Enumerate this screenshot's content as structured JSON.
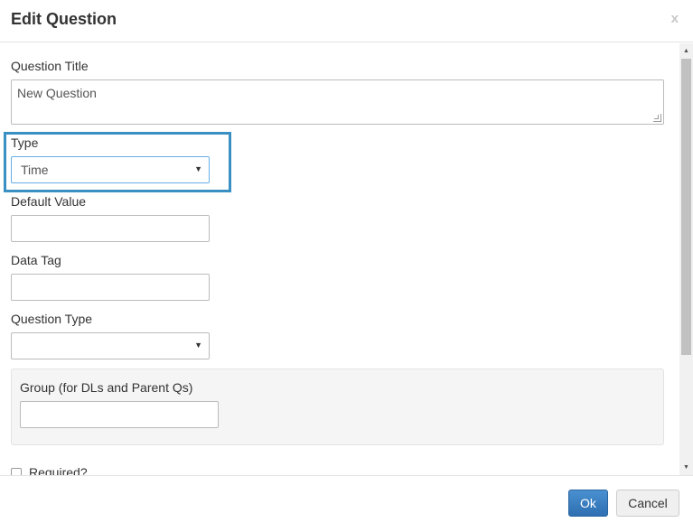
{
  "dialog": {
    "title": "Edit Question",
    "close_label": "x"
  },
  "form": {
    "question_title": {
      "label": "Question Title",
      "value": "New Question"
    },
    "type": {
      "label": "Type",
      "value": "Time"
    },
    "default_value": {
      "label": "Default Value",
      "value": ""
    },
    "data_tag": {
      "label": "Data Tag",
      "value": ""
    },
    "question_type": {
      "label": "Question Type",
      "value": ""
    },
    "group": {
      "label": "Group (for DLs and Parent Qs)",
      "value": ""
    },
    "required": {
      "label": "Required?",
      "checked": false
    }
  },
  "footer": {
    "ok_label": "Ok",
    "cancel_label": "Cancel"
  },
  "colors": {
    "highlight": "#3a8fc3",
    "primary": "#337ab7"
  }
}
